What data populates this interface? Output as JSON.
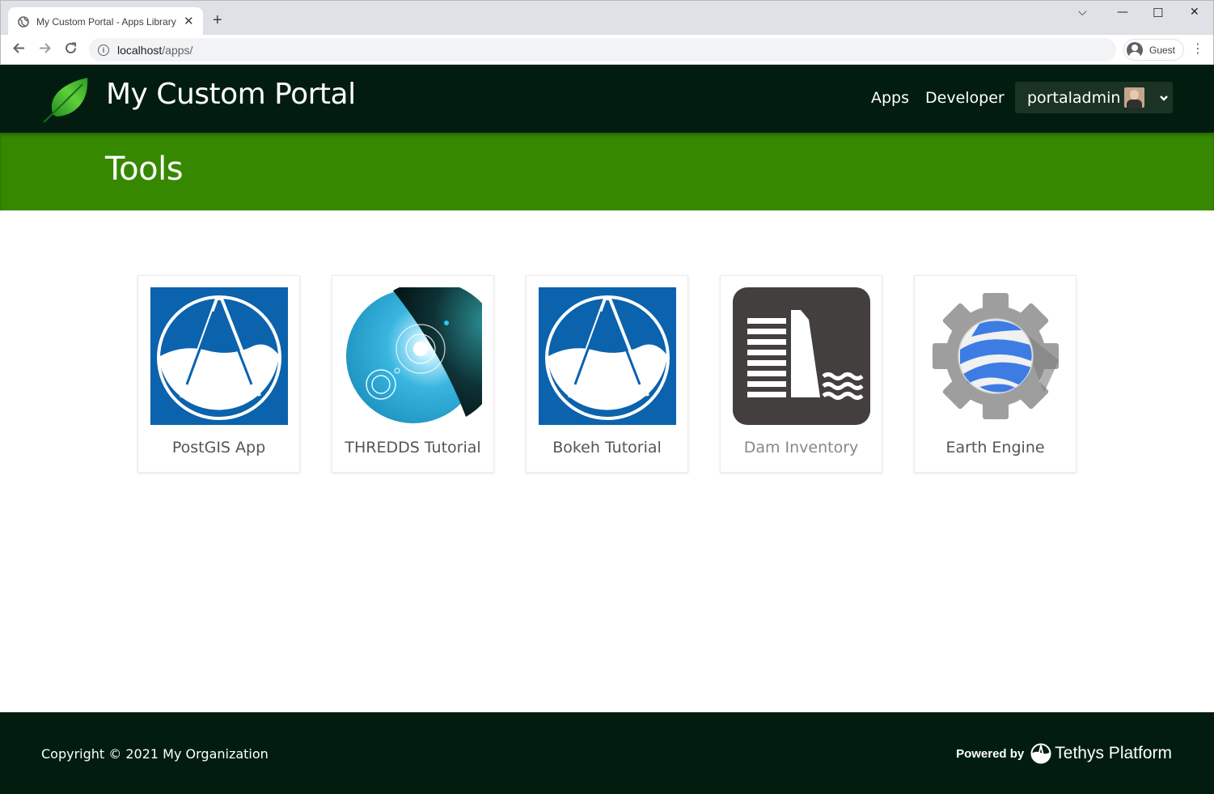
{
  "browser": {
    "tab_title": "My Custom Portal - Apps Library",
    "url_host": "localhost",
    "url_path": "/apps/",
    "profile_name": "Guest"
  },
  "header": {
    "brand": "My Custom Portal",
    "nav": [
      "Apps",
      "Developer"
    ],
    "user": "portaladmin"
  },
  "page": {
    "title": "Tools"
  },
  "apps": [
    {
      "name": "PostGIS App",
      "icon": "tethys-arch-icon"
    },
    {
      "name": "THREDDS Tutorial",
      "icon": "thredds-orb-icon"
    },
    {
      "name": "Bokeh Tutorial",
      "icon": "tethys-arch-icon"
    },
    {
      "name": "Dam Inventory",
      "icon": "dam-icon"
    },
    {
      "name": "Earth Engine",
      "icon": "earth-engine-gear-icon"
    }
  ],
  "footer": {
    "copyright": "Copyright © 2021 My Organization",
    "powered_by": "Powered by",
    "platform": "Tethys Platform"
  },
  "colors": {
    "header_bg": "#021d10",
    "band_bg": "#368800",
    "app_blue": "#0b62ad",
    "dam_bg": "#433f3f"
  }
}
